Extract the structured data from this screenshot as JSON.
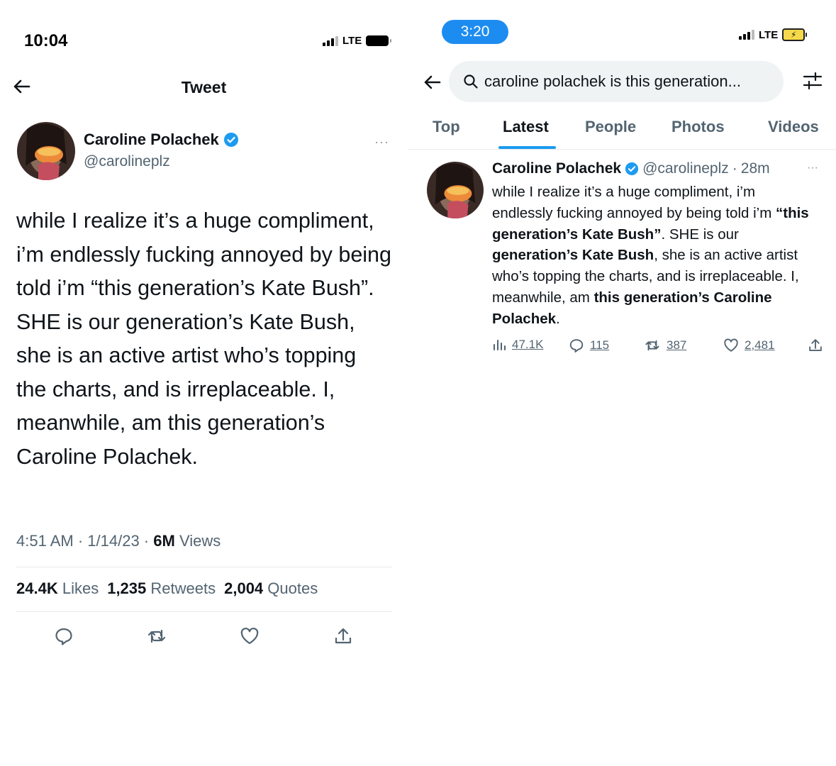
{
  "left": {
    "status_bar": {
      "time": "10:04",
      "network": "LTE"
    },
    "header": {
      "title": "Tweet"
    },
    "author": {
      "name": "Caroline Polachek",
      "handle": "@carolineplz"
    },
    "tweet_text": "while I realize it’s a huge compliment, i’m endlessly fucking annoyed by being told i’m “this generation’s Kate Bush”. SHE is our generation’s Kate Bush, she is an active artist who’s topping the charts, and is irreplaceable. I, meanwhile, am this generation’s Caroline Polachek.",
    "meta": {
      "time": "4:51 AM",
      "date": "1/14/23",
      "views_count": "6M",
      "views_label": "Views"
    },
    "stats": {
      "likes_count": "24.4K",
      "likes_label": "Likes",
      "retweets_count": "1,235",
      "retweets_label": "Retweets",
      "quotes_count": "2,004",
      "quotes_label": "Quotes"
    }
  },
  "right": {
    "status_bar": {
      "time": "3:20",
      "network": "LTE"
    },
    "search": {
      "query": "caroline polachek is this generation..."
    },
    "tabs": [
      {
        "label": "Top"
      },
      {
        "label": "Latest",
        "active": true
      },
      {
        "label": "People"
      },
      {
        "label": "Photos"
      },
      {
        "label": "Videos"
      }
    ],
    "tweet": {
      "name": "Caroline Polachek",
      "handle": "@carolineplz",
      "separator": "·",
      "age": "28m",
      "text_parts": {
        "p1": "while I realize it’s a huge compliment, i’m endlessly fucking annoyed by being told i’m ",
        "b1": "“this generation’s Kate Bush”",
        "p2": ". SHE is our ",
        "b2": "generation’s Kate Bush",
        "p3": ", she is an active artist who’s topping the charts, and is irreplaceable. I, meanwhile, am ",
        "b3": "this generation’s Caroline Polachek",
        "p4": "."
      },
      "metrics": {
        "views": "47.1K",
        "replies": "115",
        "retweets": "387",
        "likes": "2,481"
      }
    }
  },
  "colors": {
    "accent": "#1d9bf0",
    "verified": "#1d9bf0",
    "time_pill": "#1d8cf0",
    "battery_charging": "#f6d94a",
    "muted_text": "#536471"
  }
}
